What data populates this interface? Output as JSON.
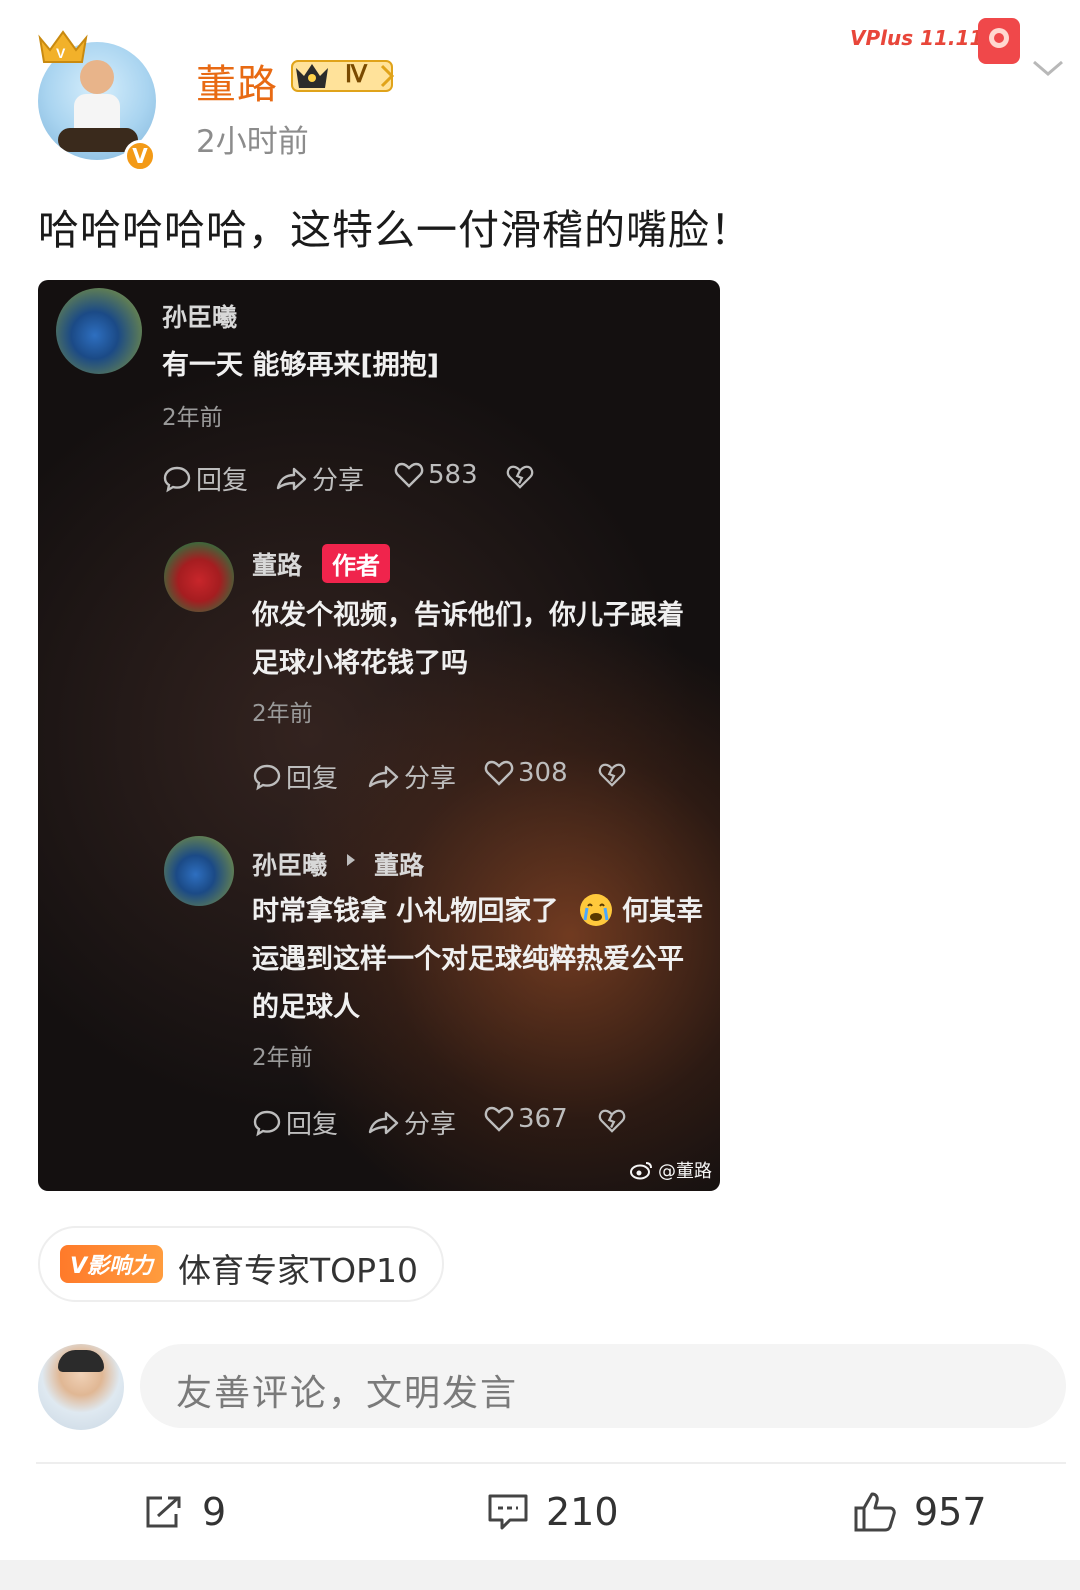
{
  "post": {
    "username": "董路",
    "rank_label": "Ⅳ",
    "time": "2小时前",
    "text": "哈哈哈哈哈，这特么一付滑稽的嘴脸！",
    "verified_badge": "V",
    "event_badge": "VPlus 11.11"
  },
  "embedded_screenshot": {
    "comments": [
      {
        "name": "孙臣曦",
        "text": "有一天 能够再来[拥抱]",
        "time": "2年前",
        "reply": "回复",
        "share": "分享",
        "likes": "583"
      },
      {
        "name": "董路",
        "tag": "作者",
        "text_line1": "你发个视频，告诉他们，你儿子跟着",
        "text_line2": "足球小将花钱了吗",
        "time": "2年前",
        "reply": "回复",
        "share": "分享",
        "likes": "308"
      },
      {
        "name": "孙臣曦",
        "reply_to": "董路",
        "text_line1a": "时常拿钱拿 小礼物回家了",
        "text_line1b": "何其幸",
        "text_line2": "运遇到这样一个对足球纯粹热爱公平",
        "text_line3": "的足球人",
        "time": "2年前",
        "reply": "回复",
        "share": "分享",
        "likes": "367"
      }
    ],
    "watermark": "@董路"
  },
  "influence_badge": {
    "tag": "V影响力",
    "label": "体育专家TOP10"
  },
  "comment_input": {
    "placeholder": "友善评论，文明发言"
  },
  "actions": {
    "reposts": "9",
    "comments": "210",
    "likes": "957"
  },
  "colors": {
    "username": "#e86a13",
    "author_tag": "#f0244c",
    "badge_orange": "#ff7a2a"
  }
}
